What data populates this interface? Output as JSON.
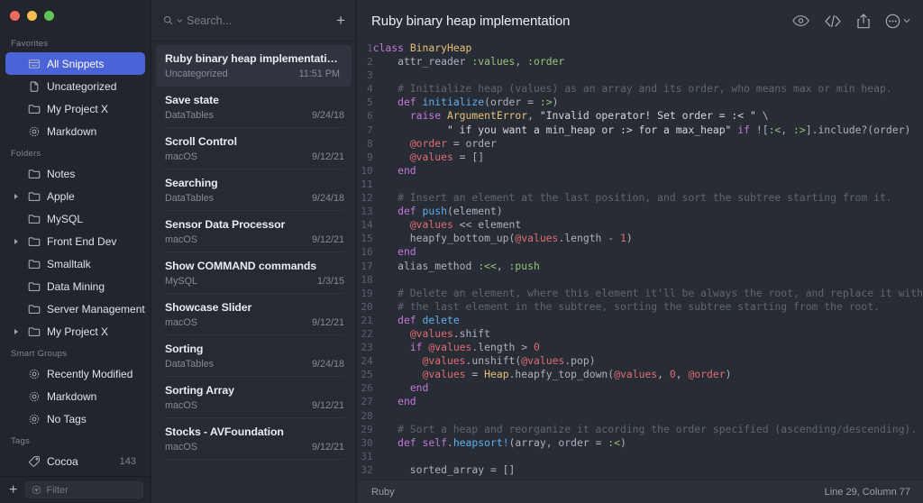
{
  "window": {
    "traffic_lights": [
      "close",
      "minimize",
      "zoom"
    ],
    "colors": {
      "accent": "#4a63d8",
      "sidebar_bg": "#22252c",
      "list_bg": "#272a33",
      "editor_bg": "#282c34"
    }
  },
  "sidebar": {
    "sections": [
      {
        "title": "Favorites",
        "items": [
          {
            "label": "All Snippets",
            "icon": "archive-box-icon",
            "selected": true,
            "disclosure": false
          },
          {
            "label": "Uncategorized",
            "icon": "document-icon",
            "selected": false,
            "disclosure": false
          },
          {
            "label": "My Project X",
            "icon": "folder-icon",
            "selected": false,
            "disclosure": false
          },
          {
            "label": "Markdown",
            "icon": "gear-icon",
            "selected": false,
            "disclosure": false
          }
        ]
      },
      {
        "title": "Folders",
        "items": [
          {
            "label": "Notes",
            "icon": "folder-icon",
            "selected": false,
            "disclosure": false
          },
          {
            "label": "Apple",
            "icon": "folder-icon",
            "selected": false,
            "disclosure": true
          },
          {
            "label": "MySQL",
            "icon": "folder-icon",
            "selected": false,
            "disclosure": false
          },
          {
            "label": "Front End Dev",
            "icon": "folder-icon",
            "selected": false,
            "disclosure": true
          },
          {
            "label": "Smalltalk",
            "icon": "folder-icon",
            "selected": false,
            "disclosure": false
          },
          {
            "label": "Data Mining",
            "icon": "folder-icon",
            "selected": false,
            "disclosure": false
          },
          {
            "label": "Server Management",
            "icon": "folder-icon",
            "selected": false,
            "disclosure": false
          },
          {
            "label": "My Project X",
            "icon": "folder-icon",
            "selected": false,
            "disclosure": true
          }
        ]
      },
      {
        "title": "Smart Groups",
        "items": [
          {
            "label": "Recently Modified",
            "icon": "gear-icon",
            "selected": false,
            "disclosure": false
          },
          {
            "label": "Markdown",
            "icon": "gear-icon",
            "selected": false,
            "disclosure": false
          },
          {
            "label": "No Tags",
            "icon": "gear-icon",
            "selected": false,
            "disclosure": false
          }
        ]
      },
      {
        "title": "Tags",
        "items": [
          {
            "label": "Cocoa",
            "icon": "tag-icon",
            "selected": false,
            "disclosure": false,
            "count": "143"
          }
        ]
      }
    ],
    "footer": {
      "add_label": "+",
      "filter_placeholder": "Filter",
      "filter_value": "",
      "filter_icon": "filter-icon"
    }
  },
  "list": {
    "search": {
      "placeholder": "Search...",
      "value": "",
      "icon": "search-icon",
      "dropdown_icon": "chevron-down-icon"
    },
    "add_label": "+",
    "snippets": [
      {
        "title": "Ruby binary heap implementation",
        "folder": "Uncategorized",
        "date": "11:51 PM",
        "selected": true
      },
      {
        "title": "Save state",
        "folder": "DataTables",
        "date": "9/24/18",
        "selected": false
      },
      {
        "title": "Scroll Control",
        "folder": "macOS",
        "date": "9/12/21",
        "selected": false
      },
      {
        "title": "Searching",
        "folder": "DataTables",
        "date": "9/24/18",
        "selected": false
      },
      {
        "title": "Sensor Data Processor",
        "folder": "macOS",
        "date": "9/12/21",
        "selected": false
      },
      {
        "title": "Show COMMAND commands",
        "folder": "MySQL",
        "date": "1/3/15",
        "selected": false
      },
      {
        "title": "Showcase Slider",
        "folder": "macOS",
        "date": "9/12/21",
        "selected": false
      },
      {
        "title": "Sorting",
        "folder": "DataTables",
        "date": "9/24/18",
        "selected": false
      },
      {
        "title": "Sorting Array",
        "folder": "macOS",
        "date": "9/12/21",
        "selected": false
      },
      {
        "title": "Stocks - AVFoundation",
        "folder": "macOS",
        "date": "9/12/21",
        "selected": false
      }
    ]
  },
  "editor": {
    "title": "Ruby binary heap implementation",
    "tools": [
      {
        "name": "preview-icon",
        "label": ""
      },
      {
        "name": "code-icon",
        "label": ""
      },
      {
        "name": "share-icon",
        "label": ""
      },
      {
        "name": "more-icon",
        "label": ""
      }
    ],
    "status": {
      "language": "Ruby",
      "cursor": "Line 29, Column 77"
    },
    "code_lines": [
      {
        "n": "1",
        "tokens": [
          {
            "t": "class ",
            "c": "k"
          },
          {
            "t": "BinaryHeap",
            "c": "ty"
          }
        ]
      },
      {
        "n": "2",
        "tokens": [
          {
            "t": "    attr_reader ",
            "c": "op"
          },
          {
            "t": ":values",
            "c": "sy"
          },
          {
            "t": ", ",
            "c": "op"
          },
          {
            "t": ":order",
            "c": "sy"
          }
        ]
      },
      {
        "n": "3",
        "tokens": []
      },
      {
        "n": "4",
        "tokens": [
          {
            "t": "    # Initialize heap (values) as an array and its order, who means max or min heap.",
            "c": "cm"
          }
        ]
      },
      {
        "n": "5",
        "tokens": [
          {
            "t": "    ",
            "c": "op"
          },
          {
            "t": "def ",
            "c": "k"
          },
          {
            "t": "initialize",
            "c": "fn"
          },
          {
            "t": "(order = ",
            "c": "op"
          },
          {
            "t": ":>",
            "c": "sy"
          },
          {
            "t": ")",
            "c": "op"
          }
        ]
      },
      {
        "n": "6",
        "tokens": [
          {
            "t": "      ",
            "c": "op"
          },
          {
            "t": "raise ",
            "c": "k"
          },
          {
            "t": "ArgumentError",
            "c": "ty"
          },
          {
            "t": ", ",
            "c": "op"
          },
          {
            "t": "\"Invalid operator! Set order = :< \"",
            "c": "st"
          },
          {
            "t": " \\",
            "c": "op"
          }
        ]
      },
      {
        "n": "7",
        "tokens": [
          {
            "t": "            ",
            "c": "op"
          },
          {
            "t": "\" if you want a min_heap or :> for a max_heap\"",
            "c": "st"
          },
          {
            "t": " ",
            "c": "op"
          },
          {
            "t": "if ",
            "c": "k"
          },
          {
            "t": "![",
            "c": "op"
          },
          {
            "t": ":<",
            "c": "sy"
          },
          {
            "t": ", ",
            "c": "op"
          },
          {
            "t": ":>",
            "c": "sy"
          },
          {
            "t": "].include?(order)",
            "c": "op"
          }
        ]
      },
      {
        "n": "8",
        "tokens": [
          {
            "t": "      ",
            "c": "op"
          },
          {
            "t": "@order",
            "c": "iv"
          },
          {
            "t": " = order",
            "c": "op"
          }
        ]
      },
      {
        "n": "9",
        "tokens": [
          {
            "t": "      ",
            "c": "op"
          },
          {
            "t": "@values",
            "c": "iv"
          },
          {
            "t": " = []",
            "c": "op"
          }
        ]
      },
      {
        "n": "10",
        "tokens": [
          {
            "t": "    ",
            "c": "op"
          },
          {
            "t": "end",
            "c": "k"
          }
        ]
      },
      {
        "n": "11",
        "tokens": []
      },
      {
        "n": "12",
        "tokens": [
          {
            "t": "    # Insert an element at the last position, and sort the subtree starting from it.",
            "c": "cm"
          }
        ]
      },
      {
        "n": "13",
        "tokens": [
          {
            "t": "    ",
            "c": "op"
          },
          {
            "t": "def ",
            "c": "k"
          },
          {
            "t": "push",
            "c": "fn"
          },
          {
            "t": "(element)",
            "c": "op"
          }
        ]
      },
      {
        "n": "14",
        "tokens": [
          {
            "t": "      ",
            "c": "op"
          },
          {
            "t": "@values",
            "c": "iv"
          },
          {
            "t": " << element",
            "c": "op"
          }
        ]
      },
      {
        "n": "15",
        "tokens": [
          {
            "t": "      heapfy_bottom_up(",
            "c": "op"
          },
          {
            "t": "@values",
            "c": "iv"
          },
          {
            "t": ".length - ",
            "c": "op"
          },
          {
            "t": "1",
            "c": "iv"
          },
          {
            "t": ")",
            "c": "op"
          }
        ]
      },
      {
        "n": "16",
        "tokens": [
          {
            "t": "    ",
            "c": "op"
          },
          {
            "t": "end",
            "c": "k"
          }
        ]
      },
      {
        "n": "17",
        "tokens": [
          {
            "t": "    alias_method ",
            "c": "op"
          },
          {
            "t": ":<<",
            "c": "sy"
          },
          {
            "t": ", ",
            "c": "op"
          },
          {
            "t": ":push",
            "c": "sy"
          }
        ]
      },
      {
        "n": "18",
        "tokens": []
      },
      {
        "n": "19",
        "tokens": [
          {
            "t": "    # Delete an element, where this element it'll be always the root, and replace it with",
            "c": "cm"
          }
        ]
      },
      {
        "n": "20",
        "tokens": [
          {
            "t": "    # the last element in the subtree, sorting the subtree starting from the root.",
            "c": "cm"
          }
        ]
      },
      {
        "n": "21",
        "tokens": [
          {
            "t": "    ",
            "c": "op"
          },
          {
            "t": "def ",
            "c": "k"
          },
          {
            "t": "delete",
            "c": "fn"
          }
        ]
      },
      {
        "n": "22",
        "tokens": [
          {
            "t": "      ",
            "c": "op"
          },
          {
            "t": "@values",
            "c": "iv"
          },
          {
            "t": ".shift",
            "c": "op"
          }
        ]
      },
      {
        "n": "23",
        "tokens": [
          {
            "t": "      ",
            "c": "op"
          },
          {
            "t": "if ",
            "c": "k"
          },
          {
            "t": "@values",
            "c": "iv"
          },
          {
            "t": ".length > ",
            "c": "op"
          },
          {
            "t": "0",
            "c": "iv"
          }
        ]
      },
      {
        "n": "24",
        "tokens": [
          {
            "t": "        ",
            "c": "op"
          },
          {
            "t": "@values",
            "c": "iv"
          },
          {
            "t": ".unshift(",
            "c": "op"
          },
          {
            "t": "@values",
            "c": "iv"
          },
          {
            "t": ".pop)",
            "c": "op"
          }
        ]
      },
      {
        "n": "25",
        "tokens": [
          {
            "t": "        ",
            "c": "op"
          },
          {
            "t": "@values",
            "c": "iv"
          },
          {
            "t": " = ",
            "c": "op"
          },
          {
            "t": "Heap",
            "c": "ty"
          },
          {
            "t": ".heapfy_top_down(",
            "c": "op"
          },
          {
            "t": "@values",
            "c": "iv"
          },
          {
            "t": ", ",
            "c": "op"
          },
          {
            "t": "0",
            "c": "iv"
          },
          {
            "t": ", ",
            "c": "op"
          },
          {
            "t": "@order",
            "c": "iv"
          },
          {
            "t": ")",
            "c": "op"
          }
        ]
      },
      {
        "n": "26",
        "tokens": [
          {
            "t": "      ",
            "c": "op"
          },
          {
            "t": "end",
            "c": "k"
          }
        ]
      },
      {
        "n": "27",
        "tokens": [
          {
            "t": "    ",
            "c": "op"
          },
          {
            "t": "end",
            "c": "k"
          }
        ]
      },
      {
        "n": "28",
        "tokens": []
      },
      {
        "n": "29",
        "tokens": [
          {
            "t": "    # Sort a heap and reorganize it acording the order specified (ascending/descending).",
            "c": "cm"
          }
        ]
      },
      {
        "n": "30",
        "tokens": [
          {
            "t": "    ",
            "c": "op"
          },
          {
            "t": "def ",
            "c": "k"
          },
          {
            "t": "self",
            "c": "k"
          },
          {
            "t": ".",
            "c": "op"
          },
          {
            "t": "heapsort!",
            "c": "fn"
          },
          {
            "t": "(array, order = ",
            "c": "op"
          },
          {
            "t": ":<",
            "c": "sy"
          },
          {
            "t": ")",
            "c": "op"
          }
        ]
      },
      {
        "n": "31",
        "tokens": []
      },
      {
        "n": "32",
        "tokens": [
          {
            "t": "      sorted_array = []",
            "c": "op"
          }
        ]
      }
    ]
  }
}
